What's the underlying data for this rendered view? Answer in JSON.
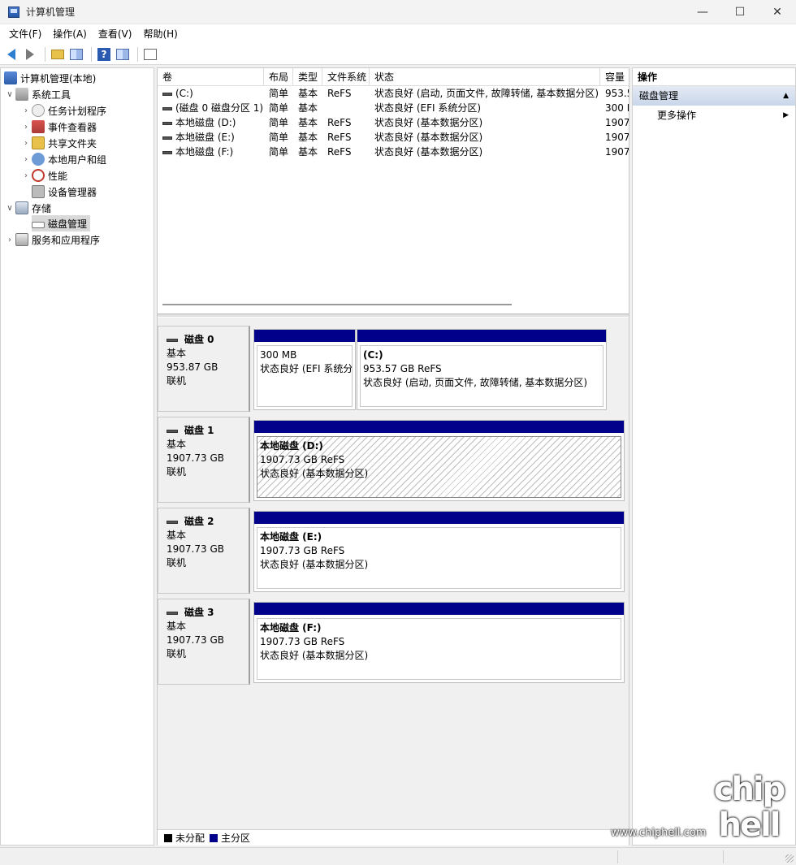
{
  "window": {
    "title": "计算机管理",
    "minimize": "—",
    "maximize": "☐",
    "close": "✕"
  },
  "menu": [
    "文件(F)",
    "操作(A)",
    "查看(V)",
    "帮助(H)"
  ],
  "toolbar": {
    "help_glyph": "?"
  },
  "tree": {
    "root": "计算机管理(本地)",
    "system_tools": "系统工具",
    "task_scheduler": "任务计划程序",
    "event_viewer": "事件查看器",
    "shared_folders": "共享文件夹",
    "local_users": "本地用户和组",
    "performance": "性能",
    "device_manager": "设备管理器",
    "storage": "存储",
    "disk_management": "磁盘管理",
    "services": "服务和应用程序"
  },
  "volume_list": {
    "headers": [
      "卷",
      "布局",
      "类型",
      "文件系统",
      "状态",
      "容量"
    ],
    "rows": [
      [
        "(C:)",
        "简单",
        "基本",
        "ReFS",
        "状态良好 (启动, 页面文件, 故障转储, 基本数据分区)",
        "953.5"
      ],
      [
        "(磁盘 0 磁盘分区 1)",
        "简单",
        "基本",
        "",
        "状态良好 (EFI 系统分区)",
        "300 I"
      ],
      [
        "本地磁盘 (D:)",
        "简单",
        "基本",
        "ReFS",
        "状态良好 (基本数据分区)",
        "1907"
      ],
      [
        "本地磁盘 (E:)",
        "简单",
        "基本",
        "ReFS",
        "状态良好 (基本数据分区)",
        "1907"
      ],
      [
        "本地磁盘 (F:)",
        "简单",
        "基本",
        "ReFS",
        "状态良好 (基本数据分区)",
        "1907"
      ]
    ]
  },
  "disks": [
    {
      "name": "磁盘 0",
      "type": "基本",
      "size": "953.87 GB",
      "status": "联机",
      "partitions": [
        {
          "title": "",
          "size": "300 MB",
          "status": "状态良好 (EFI 系统分"
        },
        {
          "title": "(C:)",
          "size": "953.57 GB ReFS",
          "status": "状态良好 (启动, 页面文件, 故障转储, 基本数据分区)"
        }
      ]
    },
    {
      "name": "磁盘 1",
      "type": "基本",
      "size": "1907.73 GB",
      "status": "联机",
      "partitions": [
        {
          "title": "本地磁盘  (D:)",
          "size": "1907.73 GB ReFS",
          "status": "状态良好 (基本数据分区)"
        }
      ]
    },
    {
      "name": "磁盘 2",
      "type": "基本",
      "size": "1907.73 GB",
      "status": "联机",
      "partitions": [
        {
          "title": "本地磁盘  (E:)",
          "size": "1907.73 GB ReFS",
          "status": "状态良好 (基本数据分区)"
        }
      ]
    },
    {
      "name": "磁盘 3",
      "type": "基本",
      "size": "1907.73 GB",
      "status": "联机",
      "partitions": [
        {
          "title": "本地磁盘  (F:)",
          "size": "1907.73 GB ReFS",
          "status": "状态良好 (基本数据分区)"
        }
      ]
    }
  ],
  "legend": {
    "unallocated": "未分配",
    "primary": "主分区",
    "unallocated_color": "#000000",
    "primary_color": "#00008b"
  },
  "actions": {
    "header": "操作",
    "section": "磁盘管理",
    "more": "更多操作",
    "caret_up": "▲",
    "arrow_right": "▶"
  },
  "watermark": {
    "site": "www.chiphell.com",
    "logo": "chip hell"
  },
  "colors": {
    "partition_bar": "#00008b",
    "selection": "#d9d9d9",
    "actions_section": "#c9d6ea"
  }
}
